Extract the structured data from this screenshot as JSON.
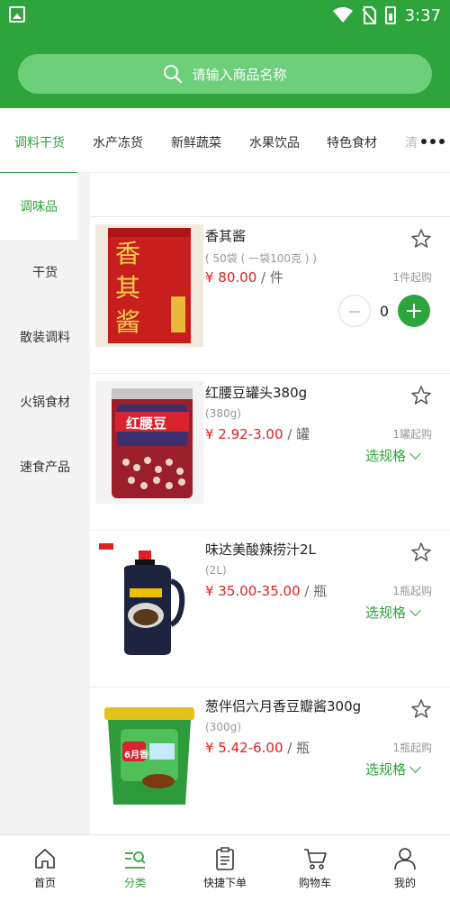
{
  "status_bar": {
    "time": "3:37"
  },
  "search": {
    "placeholder": "请输入商品名称"
  },
  "category_tabs": [
    "调料干货",
    "水产冻货",
    "新鲜蔬菜",
    "水果饮品",
    "特色食材",
    "清"
  ],
  "sidebar": [
    "调味品",
    "干货",
    "散装调料",
    "火锅食材",
    "速食产品"
  ],
  "products": [
    {
      "name": "香其酱",
      "spec": "( 50袋 ( 一袋100克 ) )",
      "price": "¥ 80.00",
      "unit": " / 件",
      "min": "1件起购",
      "quantity": "0",
      "image_text": "香其酱"
    },
    {
      "name": "红腰豆罐头380g",
      "spec": "(380g)",
      "price": "¥ 2.92-3.00",
      "unit": " / 罐",
      "min": "1罐起购",
      "spec_button": "选规格",
      "image_text": "红腰豆"
    },
    {
      "name": "味达美酸辣捞汁2L",
      "spec": "(2L)",
      "price": "¥ 35.00-35.00",
      "unit": " / 瓶",
      "min": "1瓶起购",
      "spec_button": "选规格"
    },
    {
      "name": "葱伴侣六月香豆瓣酱300g",
      "spec": "(300g)",
      "price": "¥ 5.42-6.00",
      "unit": " / 瓶",
      "min": "1瓶起购",
      "spec_button": "选规格",
      "image_text": "6月香"
    }
  ],
  "bottom_nav": [
    "首页",
    "分类",
    "快捷下单",
    "购物车",
    "我的"
  ],
  "colors": {
    "primary": "#2ea43c",
    "price": "#e02020"
  }
}
